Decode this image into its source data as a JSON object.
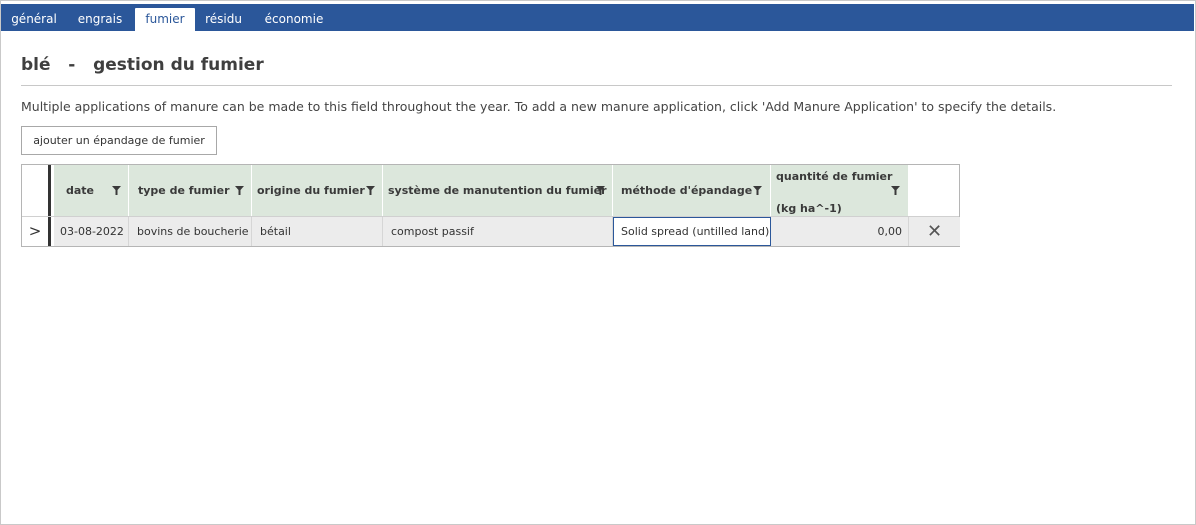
{
  "tabs": [
    {
      "label": "général",
      "active": false
    },
    {
      "label": "engrais",
      "active": false
    },
    {
      "label": "fumier",
      "active": true
    },
    {
      "label": "résidu",
      "active": false
    },
    {
      "label": "économie",
      "active": false
    }
  ],
  "page": {
    "title": "blé   -   gestion du fumier",
    "description": "Multiple applications of manure can be made to this field throughout the year. To add a new manure application, click 'Add Manure Application' to specify the details.",
    "add_button": "ajouter un épandage de fumier"
  },
  "table": {
    "columns": [
      {
        "label": "date"
      },
      {
        "label": "type de fumier"
      },
      {
        "label": "origine du fumier"
      },
      {
        "label": "système de manutention du fumier"
      },
      {
        "label": "méthode d'épandage"
      },
      {
        "label": "quantité de fumier",
        "unit": "(kg ha^-1)"
      }
    ],
    "rows": [
      {
        "expander": ">",
        "date": "03-08-2022",
        "type": "bovins de boucherie",
        "origin": "bétail",
        "system": "compost passif",
        "method": "Solid spread (untilled land)",
        "quantity": "0,00",
        "delete": "✕"
      }
    ]
  },
  "colors": {
    "tabbar": "#2b579a",
    "header": "#dce7dc",
    "row": "#ececec"
  },
  "icons": {
    "filter": "filter-icon",
    "delete": "close-icon",
    "expand": "chevron-right-icon"
  }
}
